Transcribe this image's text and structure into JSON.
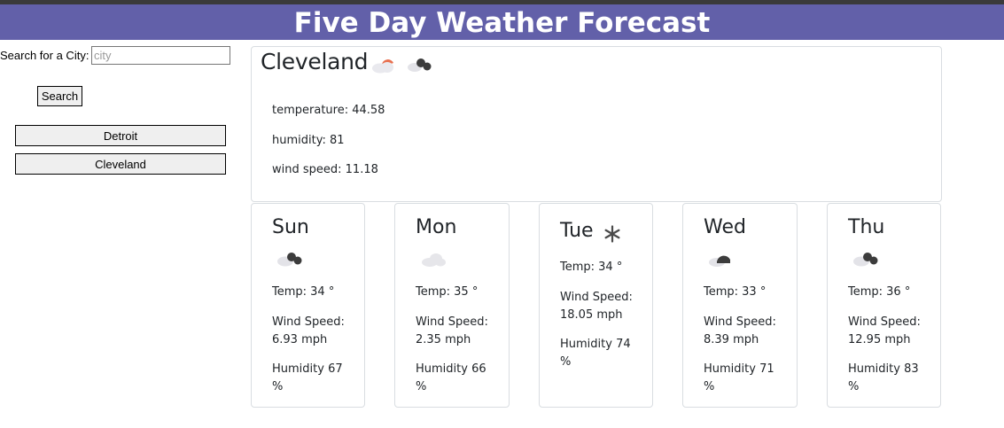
{
  "header": {
    "title": "Five Day Weather Forecast"
  },
  "search": {
    "label": "Search for a City:",
    "placeholder": "city",
    "value": "",
    "button_label": "Search"
  },
  "history": [
    "Detroit",
    "Cleveland"
  ],
  "current": {
    "city": "Cleveland",
    "icons": [
      "partly-cloudy-day-icon",
      "cloudy-night-icon"
    ],
    "temperature_text": "temperature: 44.58",
    "humidity_text": "humidity: 81",
    "wind_text": "wind speed: 11.18"
  },
  "forecast": [
    {
      "day": "Sun",
      "icon": "cloudy-night-icon",
      "temp": "Temp: 34 °",
      "wind": "Wind Speed: 6.93 mph",
      "humidity": "Humidity 67 %"
    },
    {
      "day": "Mon",
      "icon": "cloud-icon",
      "temp": "Temp: 35 °",
      "wind": "Wind Speed: 2.35 mph",
      "humidity": "Humidity 66 %"
    },
    {
      "day": "Tue",
      "icon": "snowflake-icon",
      "temp": "Temp: 34 °",
      "wind": "Wind Speed: 18.05 mph",
      "humidity": "Humidity 74 %"
    },
    {
      "day": "Wed",
      "icon": "dark-cloud-icon",
      "temp": "Temp: 33 °",
      "wind": "Wind Speed: 8.39 mph",
      "humidity": "Humidity 71 %"
    },
    {
      "day": "Thu",
      "icon": "cloudy-night-icon",
      "temp": "Temp: 36 °",
      "wind": "Wind Speed: 12.95 mph",
      "humidity": "Humidity 83 %"
    }
  ],
  "colors": {
    "header_bg": "#6260a9",
    "card_border": "#d9dde1",
    "button_bg": "#efefef"
  }
}
